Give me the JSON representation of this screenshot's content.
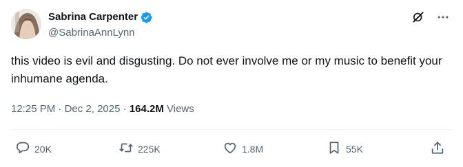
{
  "author": {
    "display_name": "Sabrina Carpenter",
    "handle": "@SabrinaAnnLynn",
    "verified": true
  },
  "header_icons": [
    "grok-icon",
    "more-icon"
  ],
  "tweet": {
    "text": "this video is evil and disgusting. Do not ever involve me or my music to benefit your inhumane agenda."
  },
  "meta": {
    "time": "12:25 PM",
    "separator": "·",
    "date": "Dec 2, 2025",
    "views_count": "164.2M",
    "views_label": "Views"
  },
  "actions": {
    "replies": "20K",
    "reposts": "225K",
    "likes": "1.8M",
    "bookmarks": "55K"
  },
  "colors": {
    "text": "#0f1419",
    "secondary": "#536471",
    "verified": "#1d9bf0",
    "divider": "#eff3f4"
  }
}
